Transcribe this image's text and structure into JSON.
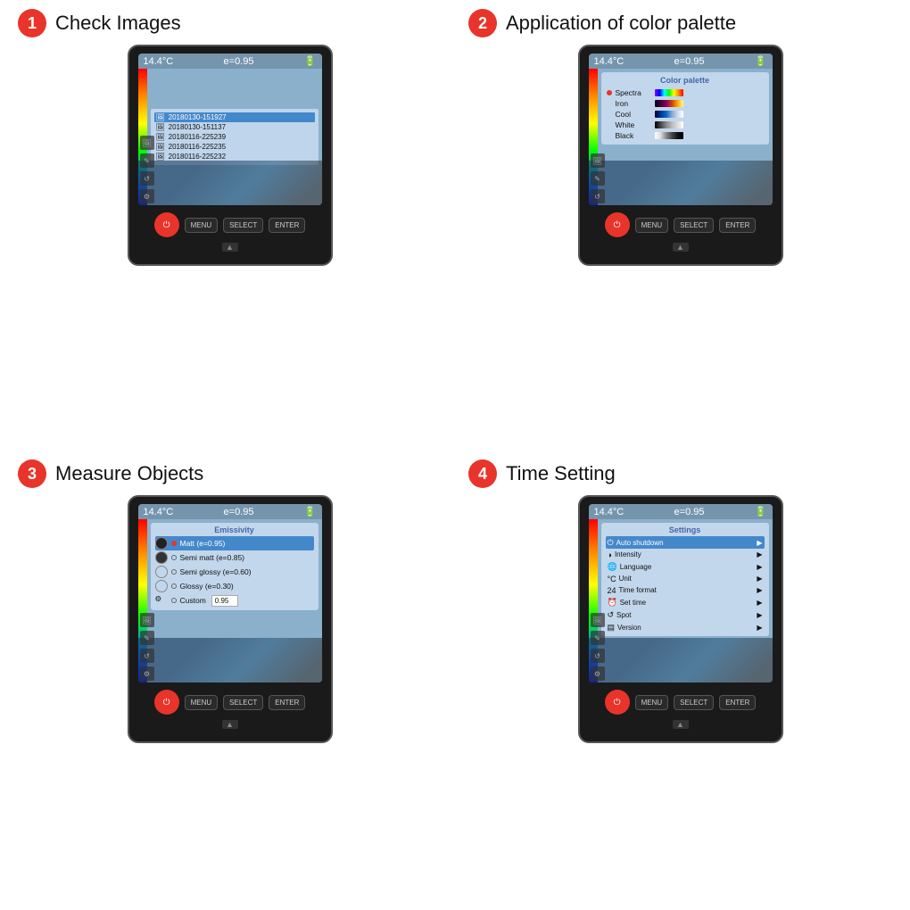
{
  "sections": [
    {
      "id": "check-images",
      "step": "❶",
      "title": "Check Images",
      "screen": {
        "temp": "14.4°C",
        "emissivity": "e=0.95",
        "files": [
          {
            "name": "20180130-151927",
            "selected": true
          },
          {
            "name": "20180130-151137",
            "selected": false
          },
          {
            "name": "20180116-225239",
            "selected": false
          },
          {
            "name": "20180116-225235",
            "selected": false
          },
          {
            "name": "20180116-225232",
            "selected": false
          }
        ]
      }
    },
    {
      "id": "color-palette",
      "step": "❷",
      "title": "Application of color palette",
      "screen": {
        "temp": "14.4°C",
        "emissivity": "e=0.95",
        "palette": {
          "title": "Color palette",
          "items": [
            {
              "name": "Spectra",
              "selected": true,
              "swatch": "linear-gradient(to right, #8800ff, #0000ff, #00ffff, #00ff00, #ffff00, #ff8800, #ff0000)"
            },
            {
              "name": "Iron",
              "selected": false,
              "swatch": "linear-gradient(to right, #000022, #440033, #880066, #cc4400, #ffaa00, #ffff88)"
            },
            {
              "name": "Cool",
              "selected": false,
              "swatch": "linear-gradient(to right, #000033, #003388, #0066cc, #88aacc, #ccddee, #ffffff)"
            },
            {
              "name": "White",
              "selected": false,
              "swatch": "linear-gradient(to right, #000000, #444444, #888888, #bbbbbb, #dddddd, #ffffff)"
            },
            {
              "name": "Black",
              "selected": false,
              "swatch": "linear-gradient(to right, #ffffff, #dddddd, #888888, #444444, #111111, #000000)"
            }
          ]
        }
      }
    },
    {
      "id": "measure-objects",
      "step": "❸",
      "title": "Measure Objects",
      "screen": {
        "temp": "14.4°C",
        "emissivity": "e=0.95",
        "emissivity_panel": {
          "title": "Emissivity",
          "items": [
            {
              "name": "Matt (e=0.95)",
              "selected": true
            },
            {
              "name": "Semi matt (e=0.85)",
              "selected": false
            },
            {
              "name": "Semi glossy (e=0.60)",
              "selected": false
            },
            {
              "name": "Glossy (e=0.30)",
              "selected": false
            },
            {
              "name": "Custom",
              "selected": false,
              "value": "0.95"
            }
          ]
        }
      }
    },
    {
      "id": "time-setting",
      "step": "❹",
      "title": "Time Setting",
      "screen": {
        "temp": "14.4°C",
        "emissivity": "e=0.95",
        "settings": {
          "title": "Settings",
          "items": [
            {
              "icon": "⏻",
              "name": "Auto shutdown",
              "selected": true
            },
            {
              "icon": "◑",
              "name": "Intensity",
              "selected": false
            },
            {
              "icon": "🌐",
              "name": "Language",
              "selected": false
            },
            {
              "icon": "°C",
              "name": "Unit",
              "selected": false
            },
            {
              "icon": "24",
              "name": "Time format",
              "selected": false
            },
            {
              "icon": "⏰",
              "name": "Set time",
              "selected": false
            },
            {
              "icon": "↺",
              "name": "Spot",
              "selected": false
            },
            {
              "icon": "▤",
              "name": "Version",
              "selected": false
            }
          ]
        }
      }
    }
  ],
  "buttons": {
    "power": "⏻",
    "menu": "MENU",
    "select": "SELECT",
    "enter": "ENTER"
  }
}
